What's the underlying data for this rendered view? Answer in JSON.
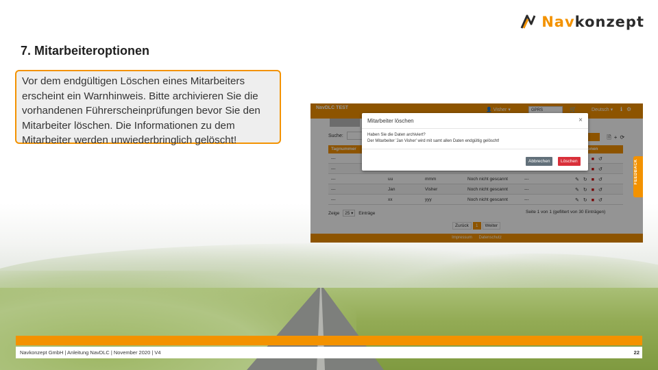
{
  "logo": {
    "text_nav": "Nav",
    "text_konzept": "konzept"
  },
  "slide": {
    "title": "7. Mitarbeiteroptionen",
    "info_text": "Vor dem endgültigen Löschen eines Mitarbeiters erscheint ein Warnhinweis. Bitte archivieren Sie die vorhandenen Führerscheinprüfungen bevor Sie den Mitarbeiter löschen. Die Informationen zu dem Mitarbeiter werden unwiederbringlich gelöscht!"
  },
  "screenshot": {
    "header": {
      "brand": "NavDLC TEST",
      "user": "Visher",
      "select": "GPRS",
      "lang": "Deutsch"
    },
    "search_label": "Suche:",
    "table": {
      "col1": "Tagnummer",
      "col_right": "onen",
      "rows": [
        {
          "c1": "---",
          "c2": "",
          "c3": "",
          "c4": "",
          "c5": ""
        },
        {
          "c1": "---",
          "c2": "",
          "c3": "",
          "c4": "",
          "c5": ""
        },
        {
          "c1": "---",
          "c2": "uu",
          "c3": "mmm",
          "c4": "Noch nicht gescannt",
          "c5": "---"
        },
        {
          "c1": "---",
          "c2": "Jan",
          "c3": "Visher",
          "c4": "Noch nicht gescannt",
          "c5": "---"
        },
        {
          "c1": "---",
          "c2": "xx",
          "c3": "yyy",
          "c4": "Noch nicht gescannt",
          "c5": "---"
        }
      ]
    },
    "page_size_prefix": "Zeige",
    "page_size": "25",
    "page_size_suffix": "Einträge",
    "page_info": "Seite 1 von 1 (gefiltert von 30 Einträgen)",
    "pager": {
      "prev": "Zurück",
      "current": "1",
      "next": "Weiter"
    },
    "footer": {
      "impressum": "Impressum",
      "datenschutz": "Datenschutz"
    },
    "feedback": "FEEDBACK",
    "modal": {
      "title": "Mitarbeiter löschen",
      "close": "×",
      "line1": "Haben Sie die Daten archiviert?",
      "line2": "Der Mitarbeiter 'Jan Visher' wird mit samt allen Daten endgültig gelöscht!",
      "cancel": "Abbrechen",
      "delete": "Löschen"
    }
  },
  "footer": {
    "text": "Navkonzept GmbH | Anleitung NavDLC | November 2020 | V4",
    "page_number": "22"
  },
  "colors": {
    "accent": "#f39200",
    "danger": "#d9303a",
    "cancel": "#62707a"
  }
}
